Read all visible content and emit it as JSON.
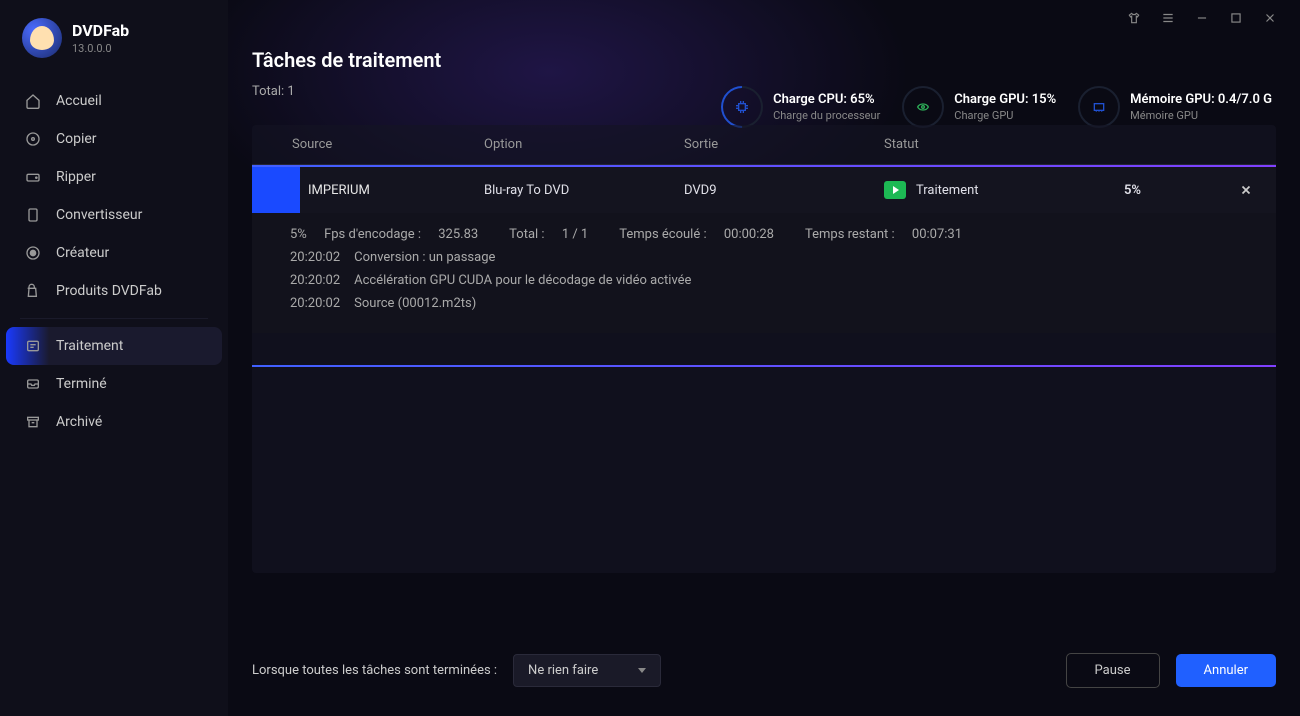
{
  "app": {
    "name": "DVDFab",
    "version": "13.0.0.0"
  },
  "sidebar": {
    "items": [
      {
        "label": "Accueil"
      },
      {
        "label": "Copier"
      },
      {
        "label": "Ripper"
      },
      {
        "label": "Convertisseur"
      },
      {
        "label": "Créateur"
      },
      {
        "label": "Produits DVDFab"
      }
    ],
    "bottom": [
      {
        "label": "Traitement"
      },
      {
        "label": "Terminé"
      },
      {
        "label": "Archivé"
      }
    ]
  },
  "page": {
    "title": "Tâches de traitement",
    "total_label": "Total:",
    "total_value": "1"
  },
  "stats": {
    "cpu": {
      "title": "Charge CPU: 65%",
      "sub": "Charge du processeur"
    },
    "gpu": {
      "title": "Charge GPU: 15%",
      "sub": "Charge GPU"
    },
    "mem": {
      "title": "Mémoire GPU: 0.4/7.0 G",
      "sub": "Mémoire GPU"
    }
  },
  "columns": {
    "source": "Source",
    "option": "Option",
    "output": "Sortie",
    "status": "Statut"
  },
  "task": {
    "source": "IMPERIUM",
    "option": "Blu-ray To DVD",
    "output": "DVD9",
    "status": "Traitement",
    "progress": "5%"
  },
  "log": {
    "summary": {
      "pct": "5%",
      "fps_label": "Fps d'encodage :",
      "fps": "325.83",
      "total_label": "Total :",
      "total": "1 / 1",
      "elapsed_label": "Temps écoulé :",
      "elapsed": "00:00:28",
      "remaining_label": "Temps restant :",
      "remaining": "00:07:31"
    },
    "lines": [
      {
        "time": "20:20:02",
        "text": "Conversion : un passage"
      },
      {
        "time": "20:20:02",
        "text": "Accélération GPU CUDA pour le décodage de vidéo activée"
      },
      {
        "time": "20:20:02",
        "text": "Source (00012.m2ts)"
      }
    ]
  },
  "footer": {
    "label": "Lorsque toutes les tâches sont terminées :",
    "select": "Ne rien faire",
    "pause": "Pause",
    "cancel": "Annuler"
  }
}
